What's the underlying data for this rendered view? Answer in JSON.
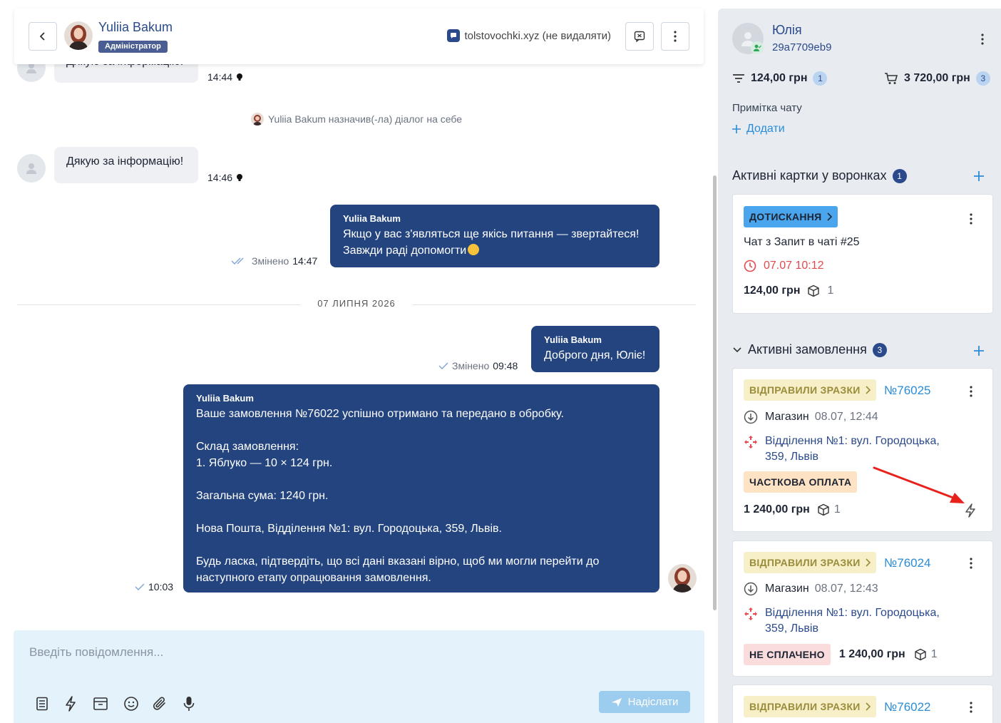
{
  "header": {
    "agent_name": "Yuliia Bakum",
    "agent_role": "Адміністратор",
    "channel_name": "tolstovochki.xyz (не видаляти)"
  },
  "messages": {
    "partial_in_text": "Дякую за інформацію!",
    "partial_in_time": "14:44",
    "system_text": "Yuliia Bakum назначив(-ла) діалог на себе",
    "in_text": "Дякую за інформацію!",
    "in_time": "14:46",
    "out1": {
      "author": "Yuliia Bakum",
      "line1": "Якщо у вас з'являться ще якісь питання — звертайтеся!",
      "line2": "Завжди раді допомогти",
      "edited": "Змінено",
      "time": "14:47"
    },
    "date_separator": "07 ЛИПНЯ 2026",
    "out2": {
      "author": "Yuliia Bakum",
      "text": "Доброго дня, Юліє!",
      "edited": "Змінено",
      "time": "09:48"
    },
    "out3": {
      "author": "Yuliia Bakum",
      "p1": "Ваше замовлення №76022 успішно отримано та передано в обробку.",
      "p2a": "Склад замовлення:",
      "p2b": "1. Яблуко — 10 × 124 грн.",
      "p3": "Загальна сума: 1240 грн.",
      "p4": "Нова Пошта, Відділення №1: вул. Городоцька, 359, Львів.",
      "p5a": "Будь ласка, підтвердіть, що всі дані вказані вірно, щоб ми могли перейти до",
      "p5b": "наступного етапу опрацювання замовлення.",
      "time": "10:03"
    }
  },
  "composer": {
    "placeholder": "Введіть повідомлення...",
    "send_label": "Надіслати"
  },
  "contact": {
    "name": "Юлія",
    "id": "29a7709eb9",
    "funnel_total": "124,00 грн",
    "funnel_count": "1",
    "cart_total": "3 720,00 грн",
    "cart_count": "3",
    "note_label": "Примітка чату",
    "add_label": "Додати"
  },
  "funnels": {
    "title": "Активні картки у воронках",
    "count": "1",
    "card": {
      "stage": "ДОТИСКАННЯ",
      "title": "Чат з Запит в чаті #25",
      "deadline": "07.07 10:12",
      "price": "124,00 грн",
      "items": "1"
    }
  },
  "orders": {
    "title": "Активні замовлення",
    "count": "3",
    "list": [
      {
        "stage": "ВІДПРАВИЛИ ЗРАЗКИ",
        "number": "№76025",
        "source": "Магазин",
        "date": "08.07, 12:44",
        "address_line1": "Відділення №1: вул. Городоцька,",
        "address_line2": "359, Львів",
        "payment": "ЧАСТКОВА ОПЛАТА",
        "price": "1 240,00 грн",
        "items": "1"
      },
      {
        "stage": "ВІДПРАВИЛИ ЗРАЗКИ",
        "number": "№76024",
        "source": "Магазин",
        "date": "08.07, 12:43",
        "address_line1": "Відділення №1: вул. Городоцька,",
        "address_line2": "359, Львів",
        "payment": "НЕ СПЛАЧЕНО",
        "price": "1 240,00 грн",
        "items": "1"
      },
      {
        "stage": "ВІДПРАВИЛИ ЗРАЗКИ",
        "number": "№76022"
      }
    ]
  },
  "colors": {
    "primary_dark": "#24447f",
    "accent_blue": "#2a8cd8",
    "side_bg": "#e8ecf1",
    "composer_bg": "#e4f3fb",
    "annotation_arrow": "#e8211b"
  }
}
